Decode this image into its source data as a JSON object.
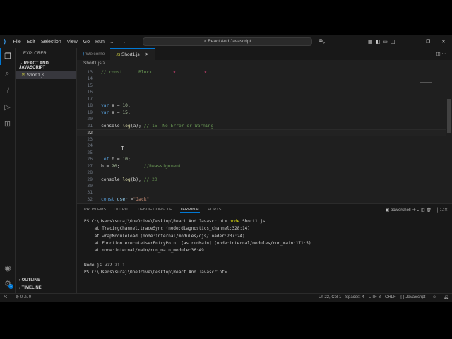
{
  "titlebar": {
    "menu": [
      "File",
      "Edit",
      "Selection",
      "View",
      "Go",
      "Run",
      "…"
    ],
    "search": "React And Javascript"
  },
  "sidebar": {
    "header": "EXPLORER",
    "folder": "REACT AND JAVASCRIPT",
    "file": "Short1.js",
    "outline": "OUTLINE",
    "timeline": "TIMELINE",
    "settings_badge": "1"
  },
  "tabs": [
    {
      "label": "Welcome"
    },
    {
      "label": "Short1.js"
    }
  ],
  "breadcrumb": "Short1.js > ...",
  "editor": {
    "lines": [
      {
        "n": "13",
        "c": "// const      Block"
      },
      {
        "n": "14",
        "c": ""
      },
      {
        "n": "15",
        "c": ""
      },
      {
        "n": "16",
        "c": ""
      },
      {
        "n": "17",
        "c": ""
      },
      {
        "n": "18",
        "c": "var a = 10;"
      },
      {
        "n": "19",
        "c": "var a = 15;"
      },
      {
        "n": "20",
        "c": ""
      },
      {
        "n": "21",
        "c": "console.log(a); // 15  No Error or Warning"
      },
      {
        "n": "22",
        "c": ""
      },
      {
        "n": "23",
        "c": ""
      },
      {
        "n": "24",
        "c": ""
      },
      {
        "n": "25",
        "c": ""
      },
      {
        "n": "26",
        "c": "let b = 10;"
      },
      {
        "n": "27",
        "c": "b = 20;         //Reassignment"
      },
      {
        "n": "28",
        "c": ""
      },
      {
        "n": "29",
        "c": "console.log(b); // 20"
      },
      {
        "n": "30",
        "c": ""
      },
      {
        "n": "31",
        "c": ""
      },
      {
        "n": "32",
        "c": "const user =\"Jack\""
      }
    ],
    "marks": [
      "✕",
      "✕"
    ]
  },
  "panel": {
    "tabs": [
      "PROBLEMS",
      "OUTPUT",
      "DEBUG CONSOLE",
      "TERMINAL",
      "PORTS"
    ],
    "shell": "powershell",
    "terminal": [
      "PS C:\\Users\\suraj\\OneDrive\\Desktop\\React And Javascript> node Short1.js",
      "    at TracingChannel.traceSync (node:diagnostics_channel:328:14)",
      "    at wrapModuleLoad (node:internal/modules/cjs/loader:237:24)",
      "    at Function.executeUserEntryPoint [as runMain] (node:internal/modules/run_main:171:5)",
      "    at node:internal/main/run_main_module:36:49",
      "",
      "Node.js v22.21.1",
      "PS C:\\Users\\suraj\\OneDrive\\Desktop\\React And Javascript> "
    ]
  },
  "status": {
    "errors": "0",
    "warnings": "0",
    "position": "Ln 22, Col 1",
    "spaces": "Spaces: 4",
    "encoding": "UTF-8",
    "eol": "CRLF",
    "language": "{ } JavaScript"
  }
}
